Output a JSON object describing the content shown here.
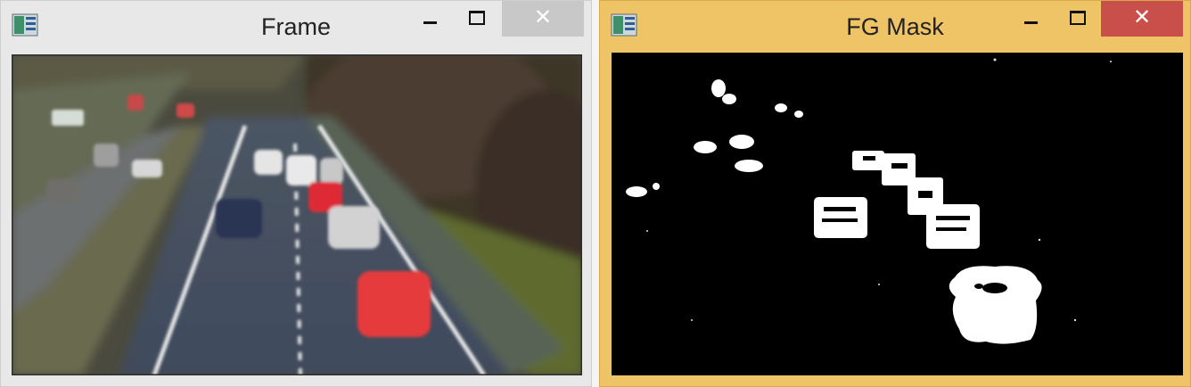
{
  "windows": [
    {
      "title": "Frame",
      "icon": "app-window-icon",
      "controls": {
        "minimize_icon": "minimize-icon",
        "maximize_icon": "maximize-icon",
        "close_label": "✕"
      },
      "content": "blurred highway traffic video frame"
    },
    {
      "title": "FG Mask",
      "icon": "app-window-icon",
      "controls": {
        "minimize_icon": "minimize-icon",
        "maximize_icon": "maximize-icon",
        "close_label": "✕"
      },
      "content": "binary foreground mask"
    }
  ],
  "colors": {
    "inactive_titlebar": "#e8e8e8",
    "active_titlebar": "#efc466",
    "close_hover": "#c9504a",
    "mask_background": "#000000",
    "mask_foreground": "#ffffff"
  }
}
